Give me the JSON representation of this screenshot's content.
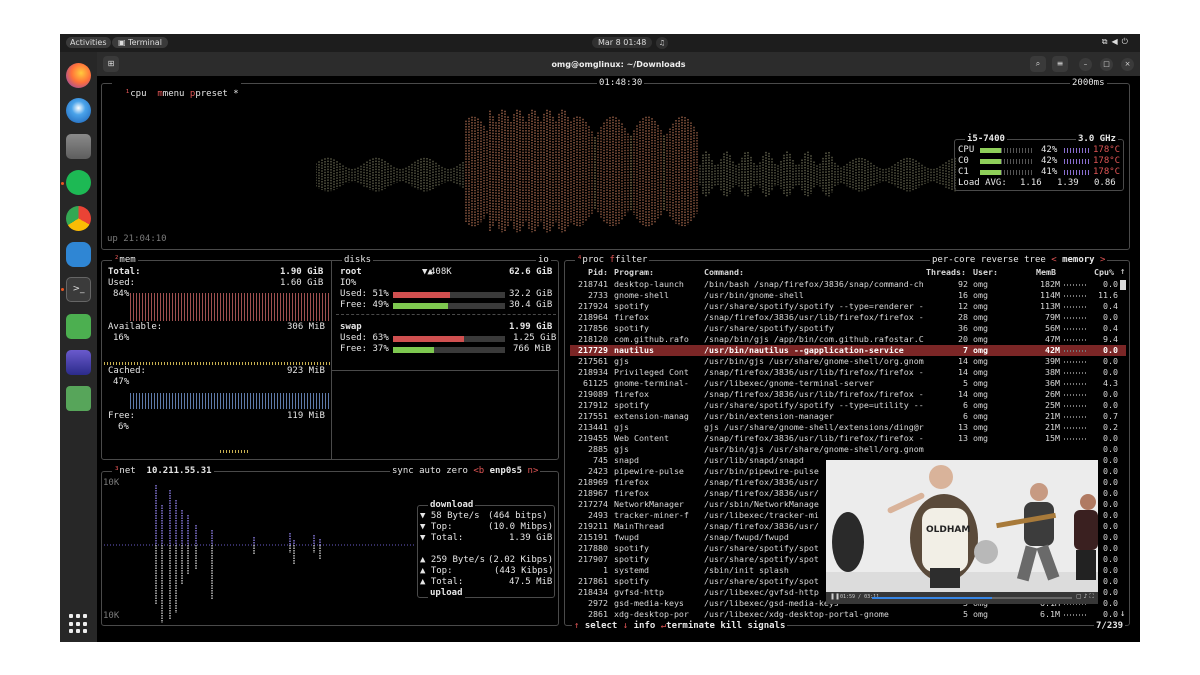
{
  "topbar": {
    "activities": "Activities",
    "app": "Terminal",
    "datetime": "Mar 8  01:48"
  },
  "window": {
    "title": "omg@omglinux: ~/Downloads"
  },
  "cpu_box": {
    "tab_cpu": "cpu",
    "tab_menu": "menu",
    "tab_preset": "preset *",
    "clock": "01:48:30",
    "interval": "2000ms",
    "uptime": "up 21:04:10",
    "model": "i5-7400",
    "freq": "3.0 GHz",
    "rows": [
      {
        "label": "CPU",
        "pct": "42%",
        "temp": "178°C"
      },
      {
        "label": "C0",
        "pct": "42%",
        "temp": "178°C"
      },
      {
        "label": "C1",
        "pct": "41%",
        "temp": "178°C"
      }
    ],
    "load_label": "Load AVG:",
    "load": [
      "1.16",
      "1.39",
      "0.86"
    ]
  },
  "mem_box": {
    "title": "mem",
    "total_label": "Total:",
    "total": "1.90 GiB",
    "used_label": "Used:",
    "used": "1.60 GiB",
    "used_pct": "84%",
    "avail_label": "Available:",
    "avail": "306 MiB",
    "avail_pct": "16%",
    "cached_label": "Cached:",
    "cached": "923 MiB",
    "cached_pct": "47%",
    "free_label": "Free:",
    "free": "119 MiB",
    "free_pct": "6%"
  },
  "disks_box": {
    "title": "disks",
    "io_tab": "io",
    "root_label": "root",
    "root_io": "408K",
    "root_size": "62.6 GiB",
    "io_label": "IO%",
    "root_used_label": "Used: 51%",
    "root_used": "32.2 GiB",
    "root_used_frac": 0.51,
    "root_free_label": "Free: 49%",
    "root_free": "30.4 GiB",
    "root_free_frac": 0.49,
    "swap_label": "swap",
    "swap_size": "1.99 GiB",
    "swap_used_label": "Used: 63%",
    "swap_used": "1.25 GiB",
    "swap_used_frac": 0.63,
    "swap_free_label": "Free: 37%",
    "swap_free": "766 MiB",
    "swap_free_frac": 0.37
  },
  "net_box": {
    "title": "net",
    "ip": "10.211.55.31",
    "sync": "sync",
    "auto": "auto",
    "zero": "zero",
    "iface_prev": "<b",
    "iface": "enp0s5",
    "iface_next": "n>",
    "scale_top": "10K",
    "scale_bottom": "10K",
    "download_label": "download",
    "dl_rate": "▼ 58 Byte/s",
    "dl_rate_bits": "(464 bitps)",
    "dl_top_label": "▼ Top:",
    "dl_top": "(10.0 Mibps)",
    "dl_total_label": "▼ Total:",
    "dl_total": "1.39 GiB",
    "ul_rate": "▲ 259 Byte/s",
    "ul_rate_bits": "(2.02 Kibps)",
    "ul_top_label": "▲ Top:",
    "ul_top": "(443 Kibps)",
    "ul_total_label": "▲ Total:",
    "ul_total": "47.5 MiB",
    "upload_label": "upload"
  },
  "proc_box": {
    "title": "proc",
    "filter": "filter",
    "percore": "per-core",
    "reverse": "reverse",
    "tree": "tree",
    "sort_prev": "<",
    "sort": "memory",
    "sort_next": ">",
    "headers": {
      "pid": "Pid:",
      "program": "Program:",
      "command": "Command:",
      "threads": "Threads:",
      "user": "User:",
      "mem": "MemB",
      "cpu": "Cpu%"
    },
    "rows": [
      {
        "pid": "218741",
        "program": "desktop-launch",
        "command": "/bin/bash /snap/firefox/3836/snap/command-cha",
        "threads": "92",
        "user": "omg",
        "mem": "182M",
        "cpu": "0.0"
      },
      {
        "pid": "2733",
        "program": "gnome-shell",
        "command": "/usr/bin/gnome-shell",
        "threads": "16",
        "user": "omg",
        "mem": "114M",
        "cpu": "11.6"
      },
      {
        "pid": "217924",
        "program": "spotify",
        "command": "/usr/share/spotify/spotify --type=renderer --",
        "threads": "12",
        "user": "omg",
        "mem": "113M",
        "cpu": "0.4"
      },
      {
        "pid": "218964",
        "program": "firefox",
        "command": "/snap/firefox/3836/usr/lib/firefox/firefox -c",
        "threads": "28",
        "user": "omg",
        "mem": "79M",
        "cpu": "0.0"
      },
      {
        "pid": "217856",
        "program": "spotify",
        "command": "/usr/share/spotify/spotify",
        "threads": "36",
        "user": "omg",
        "mem": "56M",
        "cpu": "0.4"
      },
      {
        "pid": "218120",
        "program": "com.github.rafo",
        "command": "/snap/bin/gjs /app/bin/com.github.rafostar.Cla",
        "threads": "20",
        "user": "omg",
        "mem": "47M",
        "cpu": "9.4"
      },
      {
        "pid": "217729",
        "program": "nautilus",
        "command": "/usr/bin/nautilus --gapplication-service",
        "threads": "7",
        "user": "omg",
        "mem": "42M",
        "cpu": "0.0",
        "selected": true
      },
      {
        "pid": "217561",
        "program": "gjs",
        "command": "/usr/bin/gjs /usr/share/gnome-shell/org.gnome",
        "threads": "14",
        "user": "omg",
        "mem": "39M",
        "cpu": "0.0"
      },
      {
        "pid": "218934",
        "program": "Privileged Cont",
        "command": "/snap/firefox/3836/usr/lib/firefox/firefox -c",
        "threads": "14",
        "user": "omg",
        "mem": "38M",
        "cpu": "0.0"
      },
      {
        "pid": "61125",
        "program": "gnome-terminal-",
        "command": "/usr/libexec/gnome-terminal-server",
        "threads": "5",
        "user": "omg",
        "mem": "36M",
        "cpu": "4.3"
      },
      {
        "pid": "219089",
        "program": "firefox",
        "command": "/snap/firefox/3836/usr/lib/firefox/firefox -c",
        "threads": "14",
        "user": "omg",
        "mem": "26M",
        "cpu": "0.0"
      },
      {
        "pid": "217912",
        "program": "spotify",
        "command": "/usr/share/spotify/spotify --type=utility --u",
        "threads": "6",
        "user": "omg",
        "mem": "25M",
        "cpu": "0.0"
      },
      {
        "pid": "217551",
        "program": "extension-manag",
        "command": "/usr/bin/extension-manager",
        "threads": "6",
        "user": "omg",
        "mem": "21M",
        "cpu": "0.7"
      },
      {
        "pid": "213441",
        "program": "gjs",
        "command": "gjs /usr/share/gnome-shell/extensions/ding@ra",
        "threads": "13",
        "user": "omg",
        "mem": "21M",
        "cpu": "0.2"
      },
      {
        "pid": "219455",
        "program": "Web Content",
        "command": "/snap/firefox/3836/usr/lib/firefox/firefox -c",
        "threads": "13",
        "user": "omg",
        "mem": "15M",
        "cpu": "0.0"
      },
      {
        "pid": "2885",
        "program": "gjs",
        "command": "/usr/bin/gjs /usr/share/gnome-shell/org.gnome",
        "threads": "",
        "user": "",
        "mem": "",
        "cpu": "0.0"
      },
      {
        "pid": "745",
        "program": "snapd",
        "command": "/usr/lib/snapd/snapd",
        "threads": "",
        "user": "",
        "mem": "",
        "cpu": "0.0"
      },
      {
        "pid": "2423",
        "program": "pipewire-pulse",
        "command": "/usr/bin/pipewire-pulse",
        "threads": "",
        "user": "",
        "mem": "",
        "cpu": "0.0"
      },
      {
        "pid": "218969",
        "program": "firefox",
        "command": "/snap/firefox/3836/usr/",
        "threads": "",
        "user": "",
        "mem": "",
        "cpu": "0.0"
      },
      {
        "pid": "218967",
        "program": "firefox",
        "command": "/snap/firefox/3836/usr/",
        "threads": "",
        "user": "",
        "mem": "",
        "cpu": "0.0"
      },
      {
        "pid": "217274",
        "program": "NetworkManager",
        "command": "/usr/sbin/NetworkManage",
        "threads": "",
        "user": "",
        "mem": "",
        "cpu": "0.0"
      },
      {
        "pid": "2493",
        "program": "tracker-miner-f",
        "command": "/usr/libexec/tracker-mi",
        "threads": "",
        "user": "",
        "mem": "",
        "cpu": "0.0"
      },
      {
        "pid": "219211",
        "program": "MainThread",
        "command": "/snap/firefox/3836/usr/",
        "threads": "",
        "user": "",
        "mem": "",
        "cpu": "0.0"
      },
      {
        "pid": "215191",
        "program": "fwupd",
        "command": "/snap/fwupd/fwupd",
        "threads": "",
        "user": "",
        "mem": "",
        "cpu": "0.0"
      },
      {
        "pid": "217880",
        "program": "spotify",
        "command": "/usr/share/spotify/spot",
        "threads": "",
        "user": "",
        "mem": "",
        "cpu": "0.0"
      },
      {
        "pid": "217907",
        "program": "spotify",
        "command": "/usr/share/spotify/spot",
        "threads": "",
        "user": "",
        "mem": "",
        "cpu": "0.0"
      },
      {
        "pid": "1",
        "program": "systemd",
        "command": "/sbin/init splash",
        "threads": "",
        "user": "",
        "mem": "",
        "cpu": "0.0"
      },
      {
        "pid": "217861",
        "program": "spotify",
        "command": "/usr/share/spotify/spot",
        "threads": "",
        "user": "",
        "mem": "",
        "cpu": "0.0"
      },
      {
        "pid": "218434",
        "program": "gvfsd-http",
        "command": "/usr/libexec/gvfsd-http",
        "threads": "",
        "user": "",
        "mem": "",
        "cpu": "0.0"
      },
      {
        "pid": "2972",
        "program": "gsd-media-keys",
        "command": "/usr/libexec/gsd-media-keys",
        "threads": "5",
        "user": "omg",
        "mem": "6.1M",
        "cpu": "0.0"
      },
      {
        "pid": "2861",
        "program": "xdg-desktop-por",
        "command": "/usr/libexec/xdg-desktop-portal-gnome",
        "threads": "5",
        "user": "omg",
        "mem": "6.1M",
        "cpu": "0.0"
      }
    ],
    "footer_select": "select",
    "footer_info": "info",
    "footer_terminate": "terminate",
    "footer_kill": "kill",
    "footer_signals": "signals",
    "count": "7/239"
  },
  "video": {
    "time": "01:59 / 03:11",
    "sign": "OLDHAM",
    "progress": 0.6
  },
  "colors": {
    "accent": "#e05555",
    "selected_row": "#7b2626",
    "orange": "#e95420",
    "green_bar": "#8fcf5a",
    "purple": "#8a6fd0"
  }
}
